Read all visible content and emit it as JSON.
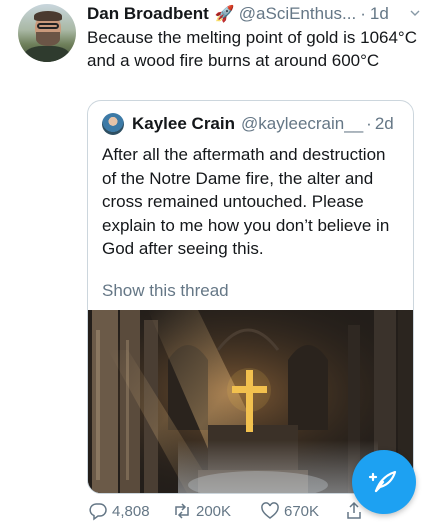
{
  "tweet": {
    "author_name": "Dan Broadbent",
    "author_emoji": "🚀",
    "handle": "@aSciEnthus...",
    "separator": "·",
    "time": "1d",
    "text": "Because the melting point of gold is 1064°C and a wood fire burns at around 600°C"
  },
  "quoted_tweet": {
    "author_name": "Kaylee Crain",
    "handle": "@kayleecrain__",
    "separator": "·",
    "time": "2d",
    "text": "After all the aftermath and destruction of the Notre Dame fire, the alter and cross remained untouched. Please explain to me how you don’t believe in God after seeing this.",
    "show_thread": "Show this thread"
  },
  "actions": {
    "reply_count": "4,808",
    "retweet_count": "200K",
    "like_count": "670K"
  },
  "icons": {
    "menu": "chevron-down-icon",
    "reply": "reply-icon",
    "retweet": "retweet-icon",
    "like": "heart-icon",
    "share": "share-icon",
    "compose": "compose-tweet-icon"
  },
  "colors": {
    "accent": "#1da1f2",
    "secondary_text": "#657786",
    "border": "#ccd6dd",
    "cross_gold": "#f2c14e"
  }
}
